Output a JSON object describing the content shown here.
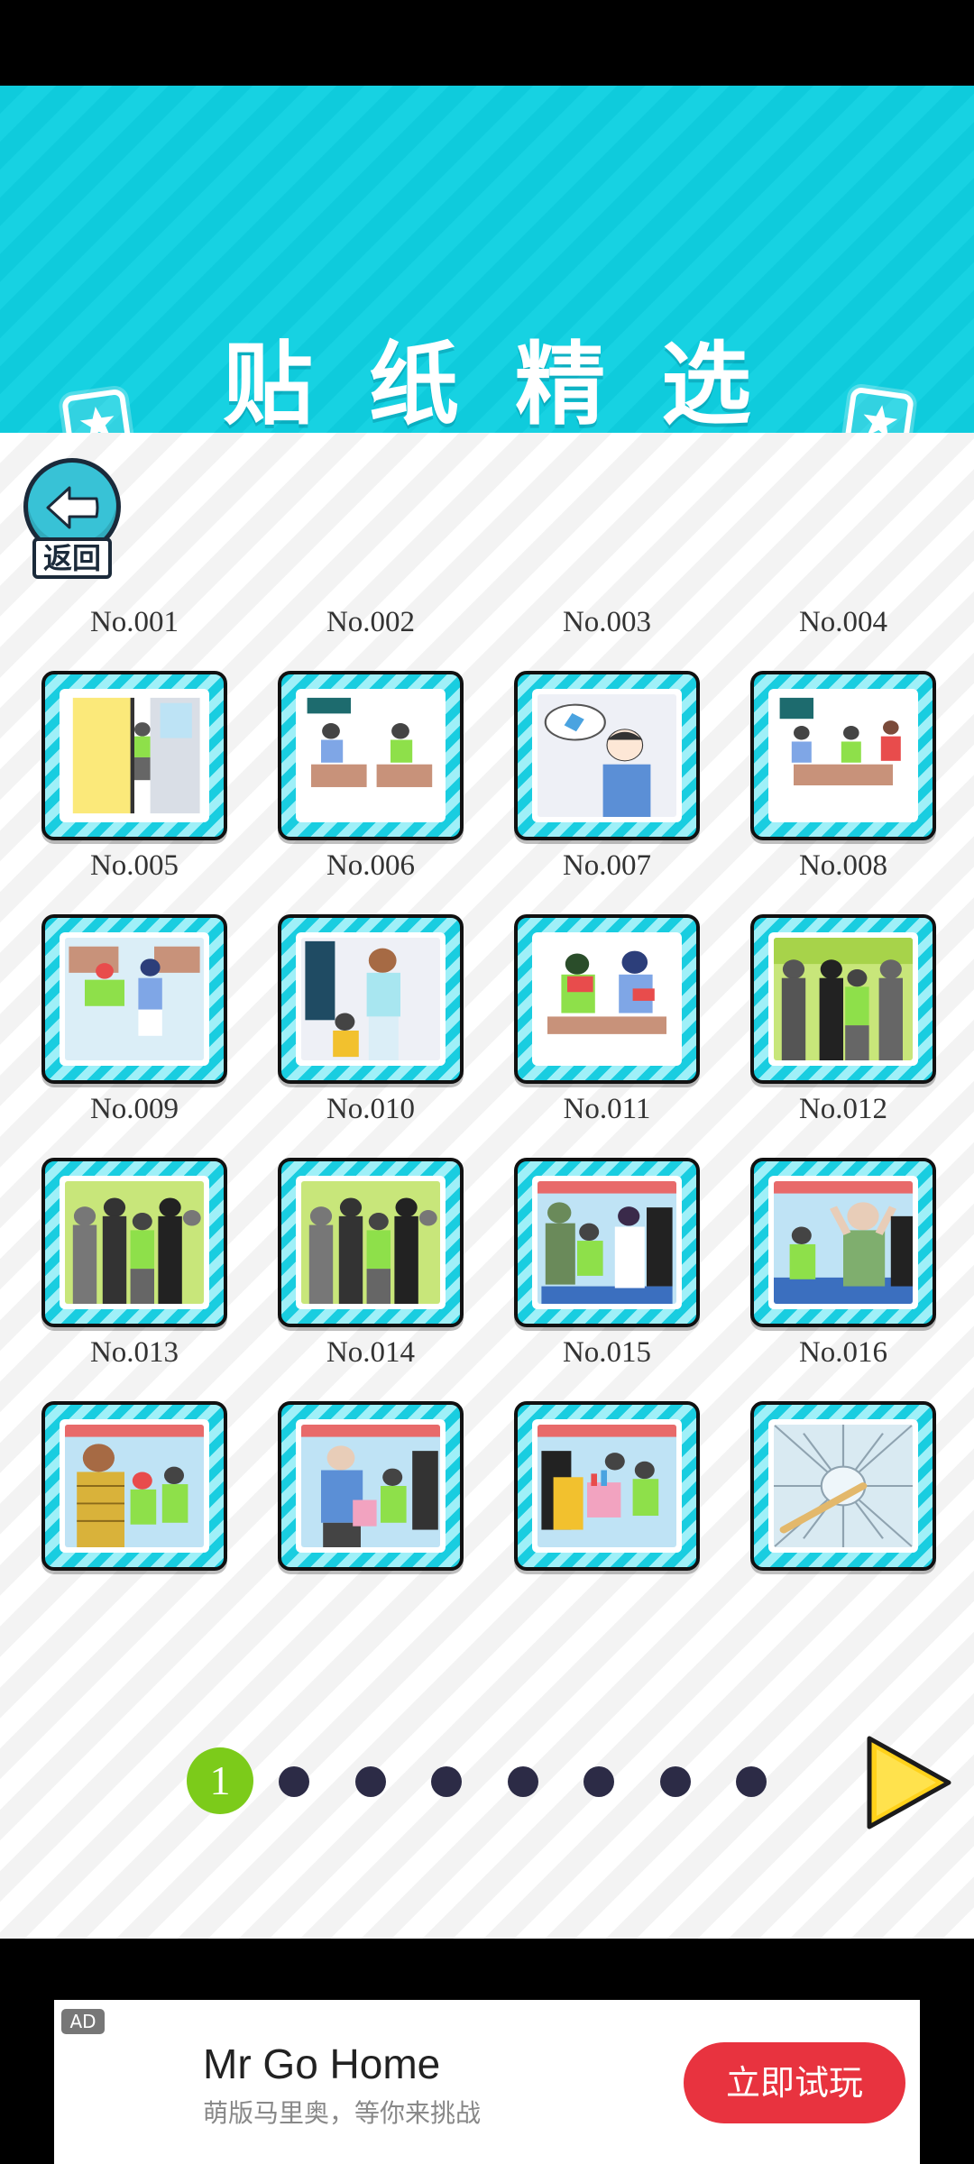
{
  "header": {
    "title": "贴纸精选"
  },
  "back_button": {
    "label": "返回"
  },
  "stickers": [
    {
      "label": "No.001",
      "scene": "door"
    },
    {
      "label": "No.002",
      "scene": "classroom"
    },
    {
      "label": "No.003",
      "scene": "thinking"
    },
    {
      "label": "No.004",
      "scene": "classroom-three"
    },
    {
      "label": "No.005",
      "scene": "desks-girl"
    },
    {
      "label": "No.006",
      "scene": "woman"
    },
    {
      "label": "No.007",
      "scene": "reading"
    },
    {
      "label": "No.008",
      "scene": "shadows"
    },
    {
      "label": "No.009",
      "scene": "shadows-green"
    },
    {
      "label": "No.010",
      "scene": "shadows-green"
    },
    {
      "label": "No.011",
      "scene": "train"
    },
    {
      "label": "No.012",
      "scene": "train-old-man"
    },
    {
      "label": "No.013",
      "scene": "train-woman"
    },
    {
      "label": "No.014",
      "scene": "train-man"
    },
    {
      "label": "No.015",
      "scene": "train-bags"
    },
    {
      "label": "No.016",
      "scene": "broken-glass"
    }
  ],
  "pager": {
    "current": "1",
    "total_pages": 8
  },
  "ad": {
    "tag": "AD",
    "title": "Mr Go Home",
    "subtitle": "萌版马里奥，等你来挑战",
    "cta": "立即试玩"
  },
  "colors": {
    "accent": "#17d2e2",
    "page_active": "#7ccb1a",
    "cta": "#e8333f"
  }
}
